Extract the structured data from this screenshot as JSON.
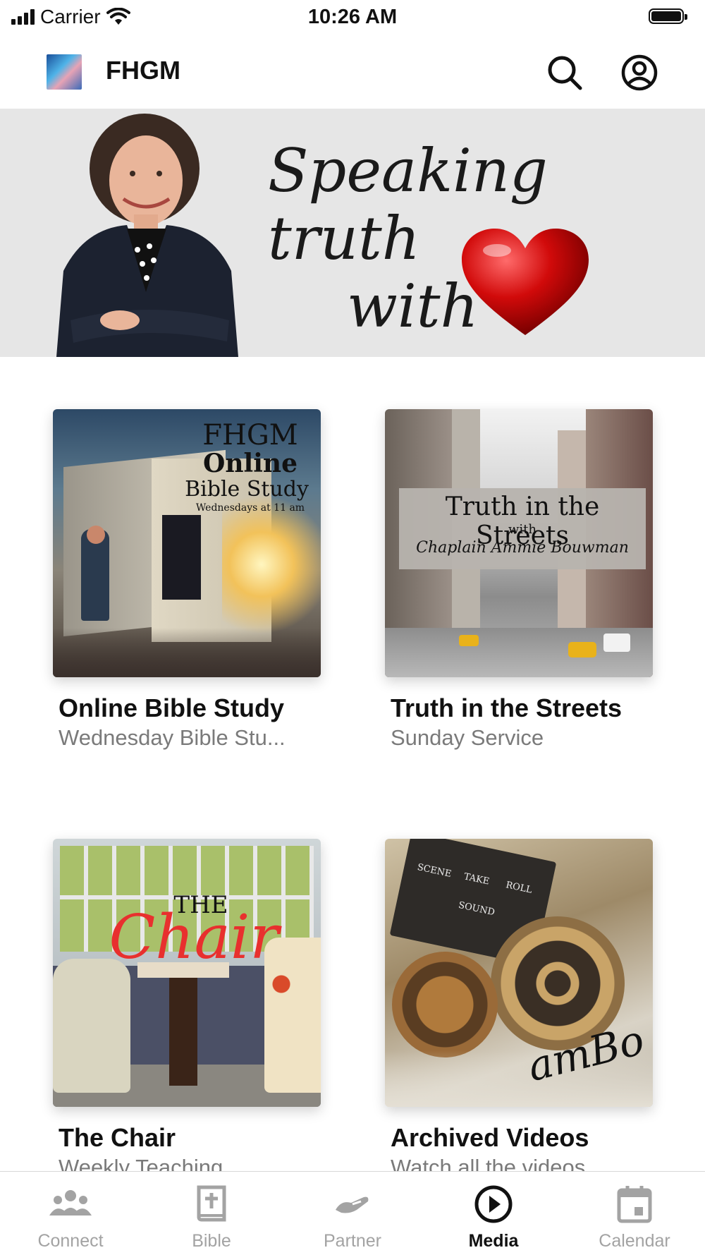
{
  "status_bar": {
    "carrier": "Carrier",
    "time": "10:26 AM"
  },
  "header": {
    "title": "FHGM"
  },
  "banner": {
    "line1": "Speaking truth",
    "line2": "with"
  },
  "cards": [
    {
      "title": "Online Bible Study",
      "subtitle": "Wednesday Bible Stu...",
      "art": {
        "line1": "FHGM",
        "line2": "Online",
        "line3": "Bible Study",
        "line4": "Wednesdays at 11 am"
      }
    },
    {
      "title": "Truth in the Streets",
      "subtitle": "Sunday Service",
      "art": {
        "line1": "Truth in the Streets",
        "line2": "with",
        "line3": "Chaplain Ammie Bouwman"
      }
    },
    {
      "title": "The Chair",
      "subtitle": "Weekly Teaching",
      "art": {
        "line1": "THE",
        "line2": "Chair"
      }
    },
    {
      "title": "Archived Videos",
      "subtitle": "Watch all the videos",
      "art": {
        "line1": "SCENE",
        "line2": "TAKE",
        "line3": "ROLL",
        "line4": "SOUND",
        "signature": "amBo"
      }
    }
  ],
  "tabs": [
    {
      "label": "Connect",
      "icon": "people-icon",
      "active": false
    },
    {
      "label": "Bible",
      "icon": "bible-icon",
      "active": false
    },
    {
      "label": "Partner",
      "icon": "handshake-icon",
      "active": false
    },
    {
      "label": "Media",
      "icon": "play-icon",
      "active": true
    },
    {
      "label": "Calendar",
      "icon": "calendar-icon",
      "active": false
    }
  ],
  "colors": {
    "accent": "#111111",
    "inactive": "#a3a3a3",
    "subtitle": "#7a7a7a",
    "heart": "#d10a0a"
  }
}
